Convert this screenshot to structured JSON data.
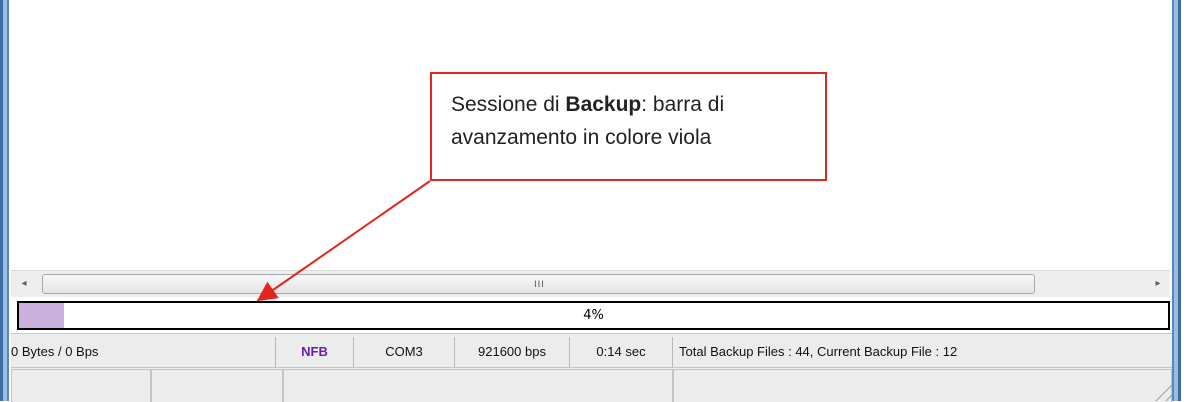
{
  "progress": {
    "percent_label": "4%",
    "value": 0.04,
    "fill_color": "#c9b0dd"
  },
  "scrollbar": {
    "left_arrow": "◂",
    "right_arrow": "▸",
    "grip": "III"
  },
  "status": {
    "bytes": "0 Bytes / 0 Bps",
    "mode": "NFB",
    "port": "COM3",
    "baud": "921600 bps",
    "elapsed": "0:14 sec",
    "files": "Total Backup Files : 44, Current Backup File : 12"
  },
  "callout": {
    "line1_prefix": "Sessione di ",
    "line1_bold": "Backup",
    "line1_suffix": ": barra di",
    "line2": "avanzamento in colore viola",
    "border_color": "#e0261e"
  },
  "colors": {
    "window_frame": "#3a6ea5",
    "nfb_text": "#6a1fa8",
    "annotation_red": "#e0261e"
  }
}
